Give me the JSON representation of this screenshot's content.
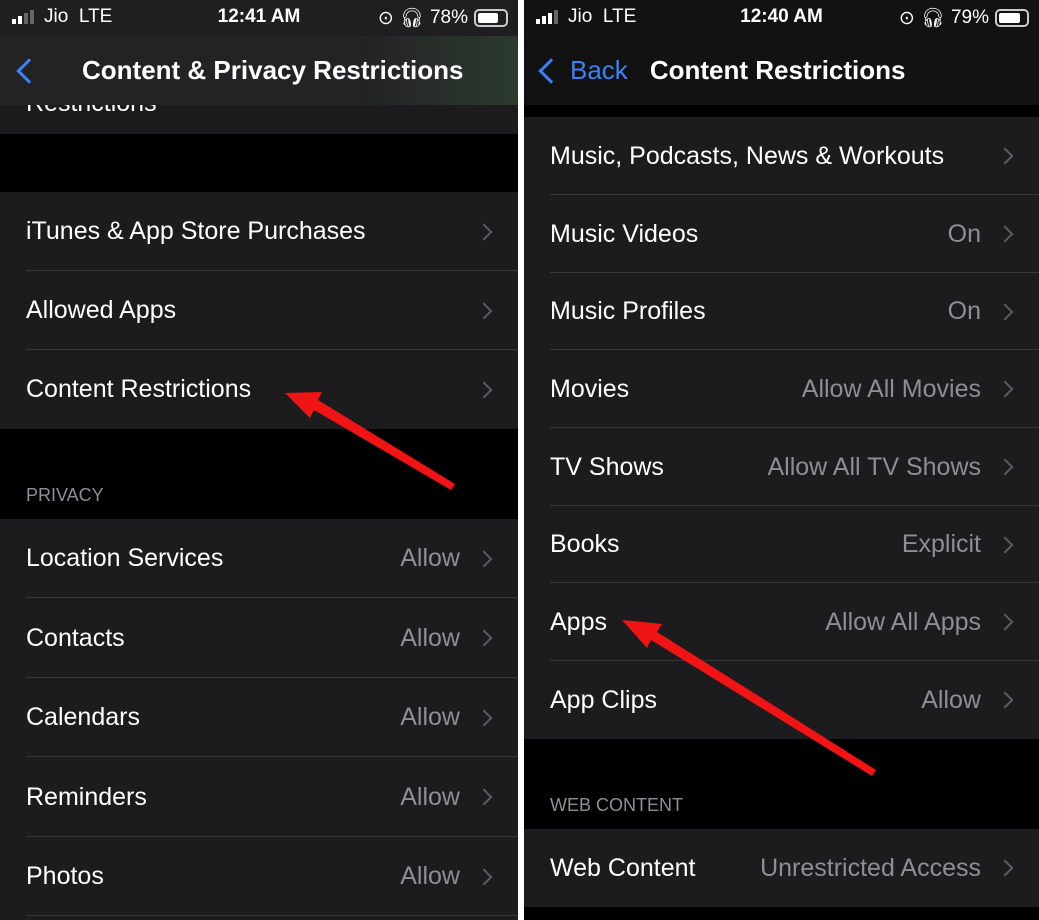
{
  "left": {
    "status": {
      "carrier": "Jio",
      "network": "LTE",
      "time": "12:41 AM",
      "battery": "78%",
      "battery_level": 78
    },
    "nav": {
      "title": "Content & Privacy Restrictions"
    },
    "partial_row": "Restrictions",
    "store_rows": [
      {
        "label": "iTunes & App Store Purchases"
      },
      {
        "label": "Allowed Apps"
      },
      {
        "label": "Content Restrictions"
      }
    ],
    "privacy_header": "PRIVACY",
    "privacy_rows": [
      {
        "label": "Location Services",
        "value": "Allow"
      },
      {
        "label": "Contacts",
        "value": "Allow"
      },
      {
        "label": "Calendars",
        "value": "Allow"
      },
      {
        "label": "Reminders",
        "value": "Allow"
      },
      {
        "label": "Photos",
        "value": "Allow"
      }
    ]
  },
  "right": {
    "status": {
      "carrier": "Jio",
      "network": "LTE",
      "time": "12:40 AM",
      "battery": "79%",
      "battery_level": 79
    },
    "nav": {
      "back": "Back",
      "title": "Content Restrictions"
    },
    "rows": [
      {
        "label": "Music, Podcasts, News & Workouts",
        "value": ""
      },
      {
        "label": "Music Videos",
        "value": "On"
      },
      {
        "label": "Music Profiles",
        "value": "On"
      },
      {
        "label": "Movies",
        "value": "Allow All Movies"
      },
      {
        "label": "TV Shows",
        "value": "Allow All TV Shows"
      },
      {
        "label": "Books",
        "value": "Explicit"
      },
      {
        "label": "Apps",
        "value": "Allow All Apps"
      },
      {
        "label": "App Clips",
        "value": "Allow"
      }
    ],
    "web_header": "WEB CONTENT",
    "web_rows": [
      {
        "label": "Web Content",
        "value": "Unrestricted Access"
      }
    ]
  },
  "colors": {
    "accent": "#3a82f7",
    "arrow": "#f01414",
    "row_bg": "#1c1c1e"
  }
}
